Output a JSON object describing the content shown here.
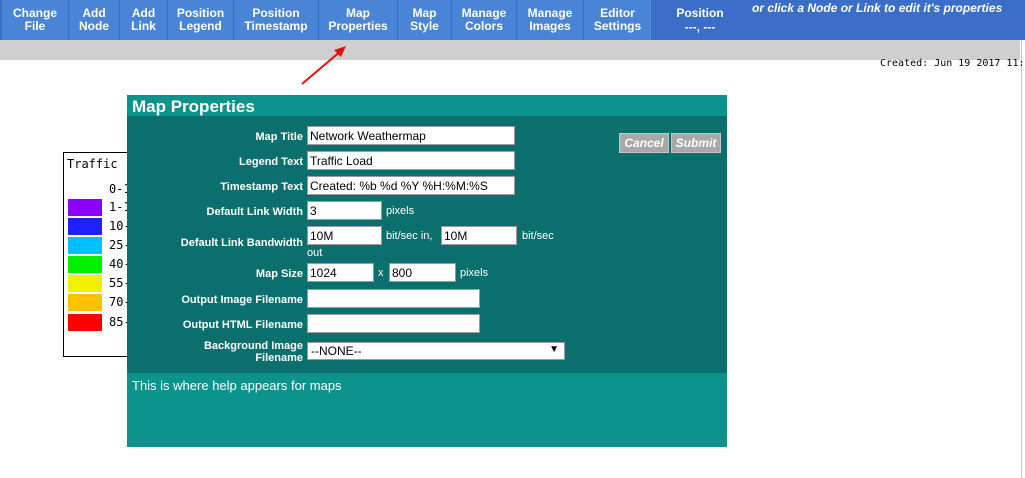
{
  "toolbar": {
    "buttons": [
      {
        "label": "Change\nFile"
      },
      {
        "label": "Add\nNode"
      },
      {
        "label": "Add\nLink"
      },
      {
        "label": "Position\nLegend"
      },
      {
        "label": "Position\nTimestamp"
      },
      {
        "label": "Map\nProperties"
      },
      {
        "label": "Map\nStyle"
      },
      {
        "label": "Manage\nColors"
      },
      {
        "label": "Manage\nImages"
      },
      {
        "label": "Editor\nSettings"
      }
    ],
    "position_label": "Position",
    "position_value": "---, ---",
    "hint": "or click a Node or Link to edit it's properties"
  },
  "created_text": "Created: Jun 19 2017 11:",
  "legend": {
    "title": "Traffic",
    "rows": [
      {
        "label": "0-1",
        "color": ""
      },
      {
        "label": "1-1",
        "color": "#8c00ff"
      },
      {
        "label": "10-",
        "color": "#2020ff"
      },
      {
        "label": "25-",
        "color": "#00c0ff"
      },
      {
        "label": "40-",
        "color": "#00f000"
      },
      {
        "label": "55-",
        "color": "#f0f000"
      },
      {
        "label": "70-",
        "color": "#ffc000"
      },
      {
        "label": "85-",
        "color": "#ff0000"
      }
    ]
  },
  "dialog": {
    "title": "Map Properties",
    "cancel_label": "Cancel",
    "submit_label": "Submit",
    "fields": {
      "map_title": {
        "label": "Map Title",
        "value": "Network Weathermap"
      },
      "legend_text": {
        "label": "Legend Text",
        "value": "Traffic Load"
      },
      "timestamp_text": {
        "label": "Timestamp Text",
        "value": "Created: %b %d %Y %H:%M:%S"
      },
      "default_link_width": {
        "label": "Default Link Width",
        "value": "3",
        "unit": "pixels"
      },
      "default_link_bandwidth": {
        "label": "Default Link Bandwidth",
        "in_value": "10M",
        "in_unit": "bit/sec in,",
        "out_value": "10M",
        "out_unit": "bit/sec",
        "out_suffix": "out"
      },
      "map_size": {
        "label": "Map Size",
        "width": "1024",
        "separator": "x",
        "height": "800",
        "unit": "pixels"
      },
      "output_image": {
        "label": "Output Image Filename",
        "value": ""
      },
      "output_html": {
        "label": "Output HTML Filename",
        "value": ""
      },
      "background_image": {
        "label": "Background Image\nFilename",
        "value": "--NONE--"
      }
    },
    "help": "This is where help appears for maps"
  },
  "colors": {
    "toolbar": "#3b6ec9",
    "button": "#4a84d6",
    "dialog": "#0b938c",
    "dialog_body": "#0b6f6e",
    "arrow": "#e01010"
  }
}
